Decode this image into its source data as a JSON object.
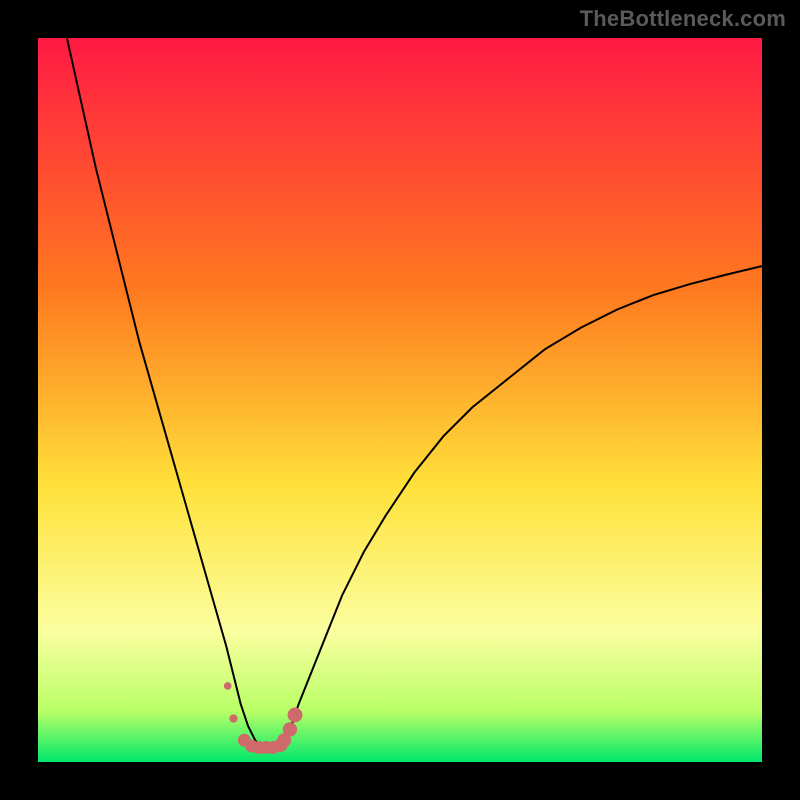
{
  "watermark": "TheBottleneck.com",
  "colors": {
    "frame": "#000000",
    "gradient_top": "#ff1a44",
    "gradient_mid1": "#ff7a1f",
    "gradient_mid2": "#ffe13a",
    "gradient_band": "#fbffa0",
    "gradient_low": "#b8ff66",
    "gradient_bottom": "#00e86b",
    "curve": "#000000",
    "marker_fill": "#cf6a6a",
    "marker_stroke": "#b15252"
  },
  "chart_data": {
    "type": "line",
    "title": "",
    "xlabel": "",
    "ylabel": "",
    "xlim": [
      0,
      100
    ],
    "ylim": [
      0,
      100
    ],
    "grid": false,
    "series": [
      {
        "name": "bottleneck-curve",
        "x": [
          4,
          6,
          8,
          10,
          12,
          14,
          16,
          18,
          20,
          22,
          24,
          26,
          27,
          28,
          29,
          30,
          31,
          32,
          33,
          34,
          35,
          36,
          38,
          40,
          42,
          45,
          48,
          52,
          56,
          60,
          65,
          70,
          75,
          80,
          85,
          90,
          95,
          100
        ],
        "y": [
          100,
          91,
          82,
          74,
          66,
          58,
          51,
          44,
          37,
          30,
          23,
          16,
          12,
          8,
          5,
          3,
          2,
          2,
          2,
          3,
          5,
          8,
          13,
          18,
          23,
          29,
          34,
          40,
          45,
          49,
          53,
          57,
          60,
          62.5,
          64.5,
          66,
          67.3,
          68.5
        ]
      }
    ],
    "markers": {
      "name": "optimal-range-markers",
      "x": [
        27.0,
        28.5,
        29.5,
        30.5,
        31.5,
        32.5,
        33.5,
        34.0,
        34.8,
        35.5
      ],
      "y": [
        6.0,
        3.0,
        2.2,
        2.0,
        2.0,
        2.0,
        2.3,
        3.0,
        4.5,
        6.5
      ],
      "r": [
        4.2,
        6.5,
        6.5,
        6.5,
        6.5,
        6.5,
        6.8,
        7.0,
        7.2,
        7.4
      ]
    },
    "isolated_marker": {
      "x": 26.2,
      "y": 10.5,
      "r": 3.8
    }
  }
}
